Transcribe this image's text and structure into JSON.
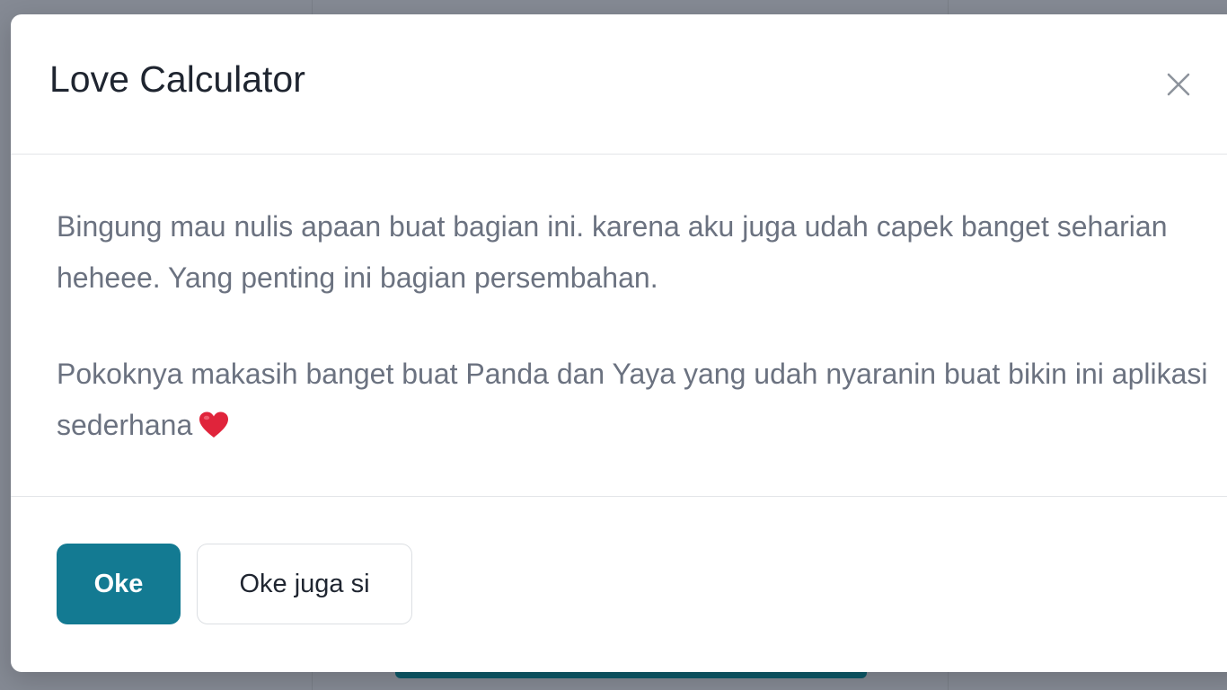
{
  "modal": {
    "title": "Love Calculator",
    "close_label": "×",
    "paragraphs": [
      "Bingung mau nulis apaan buat bagian ini. karena aku juga udah capek banget seharian heheee. Yang penting ini bagian persembahan.",
      "Pokoknya makasih banget buat Panda dan Yaya yang udah nyaranin buat bikin ini aplikasi sederhana"
    ],
    "footer": {
      "primary_label": "Oke",
      "secondary_label": "Oke juga si"
    }
  },
  "colors": {
    "backdrop": "#858a94",
    "primary": "#137a92",
    "title_text": "#1f2530",
    "body_text": "#6b7280",
    "heart": "#e0243b"
  },
  "icons": {
    "close": "close-icon",
    "heart": "heart-icon"
  }
}
